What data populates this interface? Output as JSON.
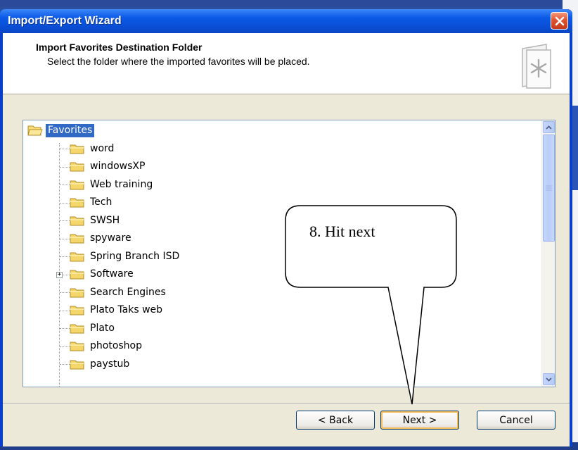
{
  "window": {
    "title": "Import/Export Wizard",
    "close_icon": "close-icon"
  },
  "header": {
    "title": "Import Favorites Destination Folder",
    "subtitle": "Select the folder where the imported favorites will be placed.",
    "icon": "favorites-book-icon"
  },
  "tree": {
    "root": {
      "label": "Favorites",
      "selected": true
    },
    "items": [
      {
        "label": "word",
        "has_children": false
      },
      {
        "label": "windowsXP",
        "has_children": false
      },
      {
        "label": "Web training",
        "has_children": false
      },
      {
        "label": "Tech",
        "has_children": false
      },
      {
        "label": "SWSH",
        "has_children": false
      },
      {
        "label": "spyware",
        "has_children": false
      },
      {
        "label": "Spring Branch ISD",
        "has_children": false
      },
      {
        "label": "Software",
        "has_children": true
      },
      {
        "label": "Search Engines",
        "has_children": false
      },
      {
        "label": "Plato Taks web",
        "has_children": false
      },
      {
        "label": "Plato",
        "has_children": false
      },
      {
        "label": "photoshop",
        "has_children": false
      },
      {
        "label": "paystub",
        "has_children": false
      }
    ],
    "expand_glyph": "+"
  },
  "annotation": {
    "text": "8. Hit next"
  },
  "buttons": {
    "back": "< Back",
    "next": "Next >",
    "cancel": "Cancel"
  },
  "colors": {
    "titlebar": "#0a54e2",
    "selection": "#316ac5",
    "dialog_face": "#ece9d8",
    "folder_yellow": "#f5d66b"
  }
}
